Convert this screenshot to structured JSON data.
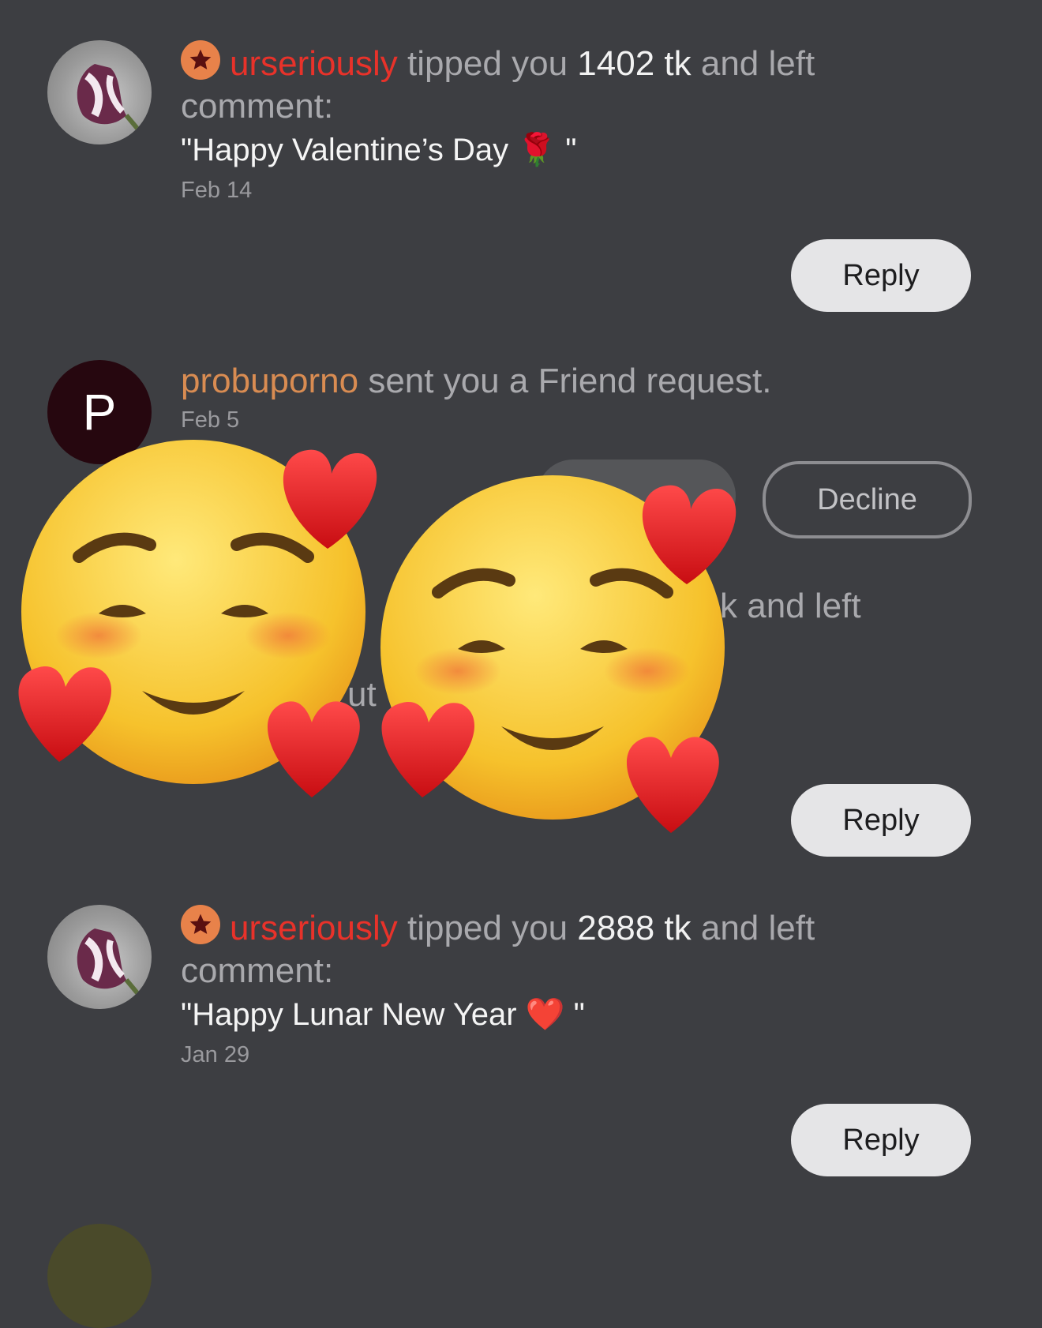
{
  "notifications": [
    {
      "user": "urseriously",
      "pre_amount": "tipped you",
      "amount": "1402 tk",
      "post_amount": "and left",
      "line2": "comment:",
      "comment": "\"Happy Valentine’s Day 🌹 \"",
      "date": "Feb 14",
      "reply_label": "Reply"
    },
    {
      "user": "probuporno",
      "action": "sent you a Friend request.",
      "avatar_letter": "P",
      "date": "Feb 5",
      "decline_label": "Decline"
    },
    {
      "partial_line1": "k and left",
      "partial_line2": "ut",
      "reply_label": "Reply"
    },
    {
      "user": "urseriously",
      "pre_amount": "tipped you",
      "amount": "2888 tk",
      "post_amount": "and left",
      "line2": "comment:",
      "comment": "\"Happy Lunar New Year ❤️ \"",
      "date": "Jan 29",
      "reply_label": "Reply"
    }
  ],
  "icons": {
    "star_badge": "star-icon",
    "overlay_emoji": "smiling-face-with-hearts-icon"
  },
  "colors": {
    "background": "#3d3e42",
    "username_red": "#e8322a",
    "username_orange": "#d98c52",
    "badge": "#e8824a",
    "reply_button": "#e5e5e7"
  }
}
